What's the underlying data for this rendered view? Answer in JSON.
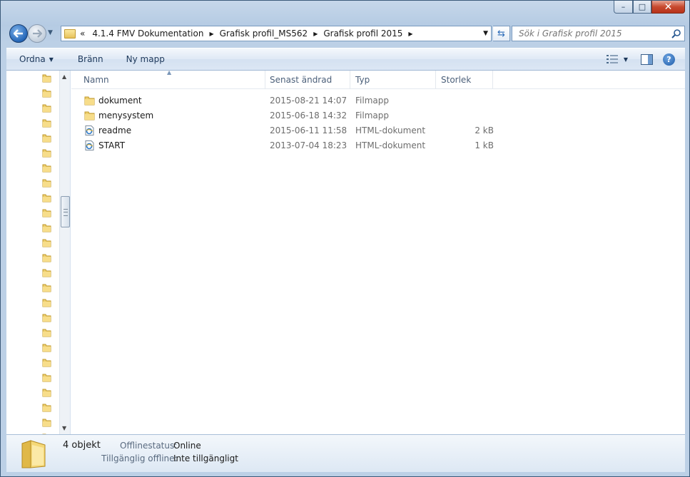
{
  "window": {
    "caption": {
      "minimize": "–",
      "maximize": "□",
      "close": "✕"
    }
  },
  "address": {
    "overflow": "«",
    "crumbs": [
      "4.1.4 FMV Dokumentation",
      "Grafisk profil_MS562",
      "Grafisk profil 2015"
    ]
  },
  "search": {
    "placeholder": "Sök i Grafisk profil 2015"
  },
  "toolbar": {
    "organize": "Ordna",
    "burn": "Bränn",
    "new_folder": "Ny mapp",
    "help": "?"
  },
  "columns": {
    "name": "Namn",
    "date": "Senast ändrad",
    "type": "Typ",
    "size": "Storlek"
  },
  "files": [
    {
      "name": "dokument",
      "date": "2015-08-21 14:07",
      "type": "Filmapp",
      "size": "",
      "icon": "folder-icon"
    },
    {
      "name": "menysystem",
      "date": "2015-06-18 14:32",
      "type": "Filmapp",
      "size": "",
      "icon": "folder-icon"
    },
    {
      "name": "readme",
      "date": "2015-06-11 11:58",
      "type": "HTML-dokument",
      "size": "2 kB",
      "icon": "html-document-icon"
    },
    {
      "name": "START",
      "date": "2013-07-04 18:23",
      "type": "HTML-dokument",
      "size": "1 kB",
      "icon": "html-document-icon"
    }
  ],
  "details": {
    "count": "4 objekt",
    "offline_status_label": "Offlinestatus:",
    "offline_status_value": "Online",
    "available_offline_label": "Tillgänglig offline:",
    "available_offline_value": "Inte tillgängligt"
  },
  "colors": {
    "accent": "#1e395b",
    "folder": "#e7c25a",
    "selection": "#cce8ff"
  }
}
